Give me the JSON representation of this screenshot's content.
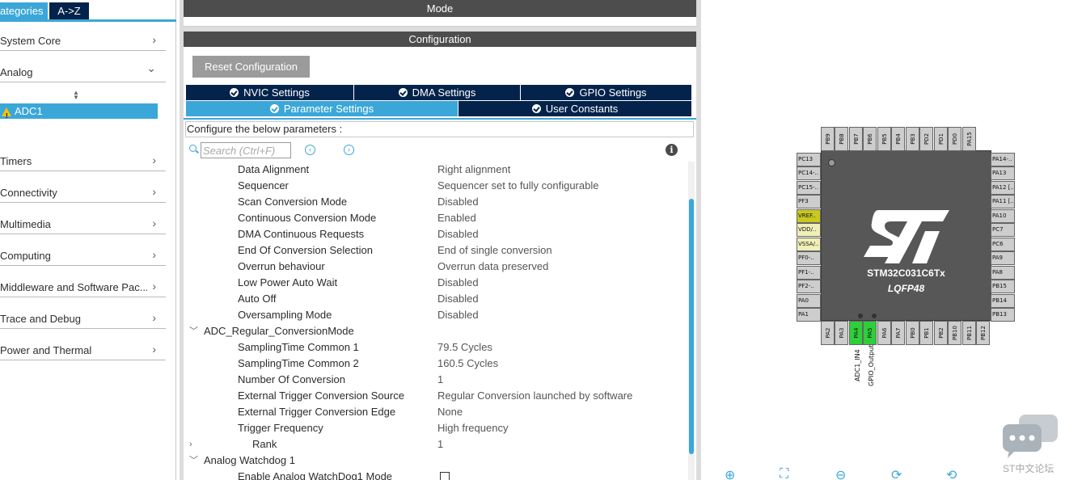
{
  "left_panel": {
    "tab_categories": "ategories",
    "tab_az": "A->Z",
    "categories": [
      {
        "label": "System Core",
        "chevron": "›"
      },
      {
        "label": "Analog",
        "chevron": "⌄"
      },
      {
        "label": "Timers",
        "chevron": "›"
      },
      {
        "label": "Connectivity",
        "chevron": "›"
      },
      {
        "label": "Multimedia",
        "chevron": "›"
      },
      {
        "label": "Computing",
        "chevron": "›"
      },
      {
        "label": "Middleware and Software Pac...",
        "chevron": "›"
      },
      {
        "label": "Trace and Debug",
        "chevron": "›"
      },
      {
        "label": "Power and Thermal",
        "chevron": "›"
      }
    ],
    "selected_item": "ADC1"
  },
  "config_panel": {
    "mode_title": "Mode",
    "configuration_title": "Configuration",
    "reset_button": "Reset Configuration",
    "tabs": [
      "NVIC Settings",
      "DMA Settings",
      "GPIO Settings",
      "Parameter Settings",
      "User Constants"
    ],
    "active_tab": "Parameter Settings",
    "configure_label": "Configure the below parameters :",
    "search_placeholder": "Search (Ctrl+F)",
    "prev_icon": "‹",
    "next_icon": "›",
    "info_icon": "i",
    "parameters": [
      {
        "name": "Data Alignment",
        "value": "Right alignment"
      },
      {
        "name": "Sequencer",
        "value": "Sequencer set to fully configurable"
      },
      {
        "name": "Scan Conversion Mode",
        "value": "Disabled"
      },
      {
        "name": "Continuous Conversion Mode",
        "value": "Enabled"
      },
      {
        "name": "DMA Continuous Requests",
        "value": "Disabled"
      },
      {
        "name": "End Of Conversion Selection",
        "value": "End of single conversion"
      },
      {
        "name": "Overrun behaviour",
        "value": "Overrun data preserved"
      },
      {
        "name": "Low Power Auto Wait",
        "value": "Disabled"
      },
      {
        "name": "Auto Off",
        "value": "Disabled"
      },
      {
        "name": "Oversampling Mode",
        "value": "Disabled"
      }
    ],
    "group_regular": "ADC_Regular_ConversionMode",
    "regular_parameters": [
      {
        "name": "SamplingTime Common 1",
        "value": "79.5 Cycles"
      },
      {
        "name": "SamplingTime Common 2",
        "value": "160.5 Cycles"
      },
      {
        "name": "Number Of Conversion",
        "value": "1"
      },
      {
        "name": "External Trigger Conversion Source",
        "value": "Regular Conversion launched by software"
      },
      {
        "name": "External Trigger Conversion Edge",
        "value": "None"
      },
      {
        "name": "Trigger Frequency",
        "value": "High frequency"
      }
    ],
    "rank": {
      "name": "Rank",
      "value": "1"
    },
    "group_watchdog": "Analog Watchdog 1",
    "watchdog_parameter": {
      "name": "Enable Analog WatchDog1 Mode",
      "checked": false
    }
  },
  "pinout": {
    "chip_name": "STM32C031C6Tx",
    "package": "LQFP48",
    "top_pins": [
      "PB9",
      "PB8",
      "PB7",
      "PB6",
      "PB5",
      "PB4",
      "PB3",
      "PD2",
      "PD1",
      "PD0",
      "PA15"
    ],
    "bottom_pins": [
      "PA2",
      "PA3",
      "PA4",
      "PA5",
      "PA6",
      "PA7",
      "PB0",
      "PB1",
      "PB2",
      "PB10",
      "PB11",
      "PB12"
    ],
    "left_pins": [
      "PC13",
      "PC14-..",
      "PC15-..",
      "PF3",
      "VREF..",
      "VDD/..",
      "VSSA/..",
      "PF0-..",
      "PF1-..",
      "PF2-..",
      "PA0",
      "PA1"
    ],
    "right_pins": [
      "PA14-..",
      "PA13",
      "PA12 [..",
      "PA11 [..",
      "PA10",
      "PC7",
      "PC6",
      "PA9",
      "PA8",
      "PB15",
      "PB14",
      "PB13"
    ],
    "pin_labels": [
      "ADC1_IN4",
      "GPIO_Output"
    ],
    "watermark": "ST中文论坛",
    "accent_green": "#2fcf3a",
    "accent_blue": "#3ba7d8",
    "navy": "#03234b"
  }
}
